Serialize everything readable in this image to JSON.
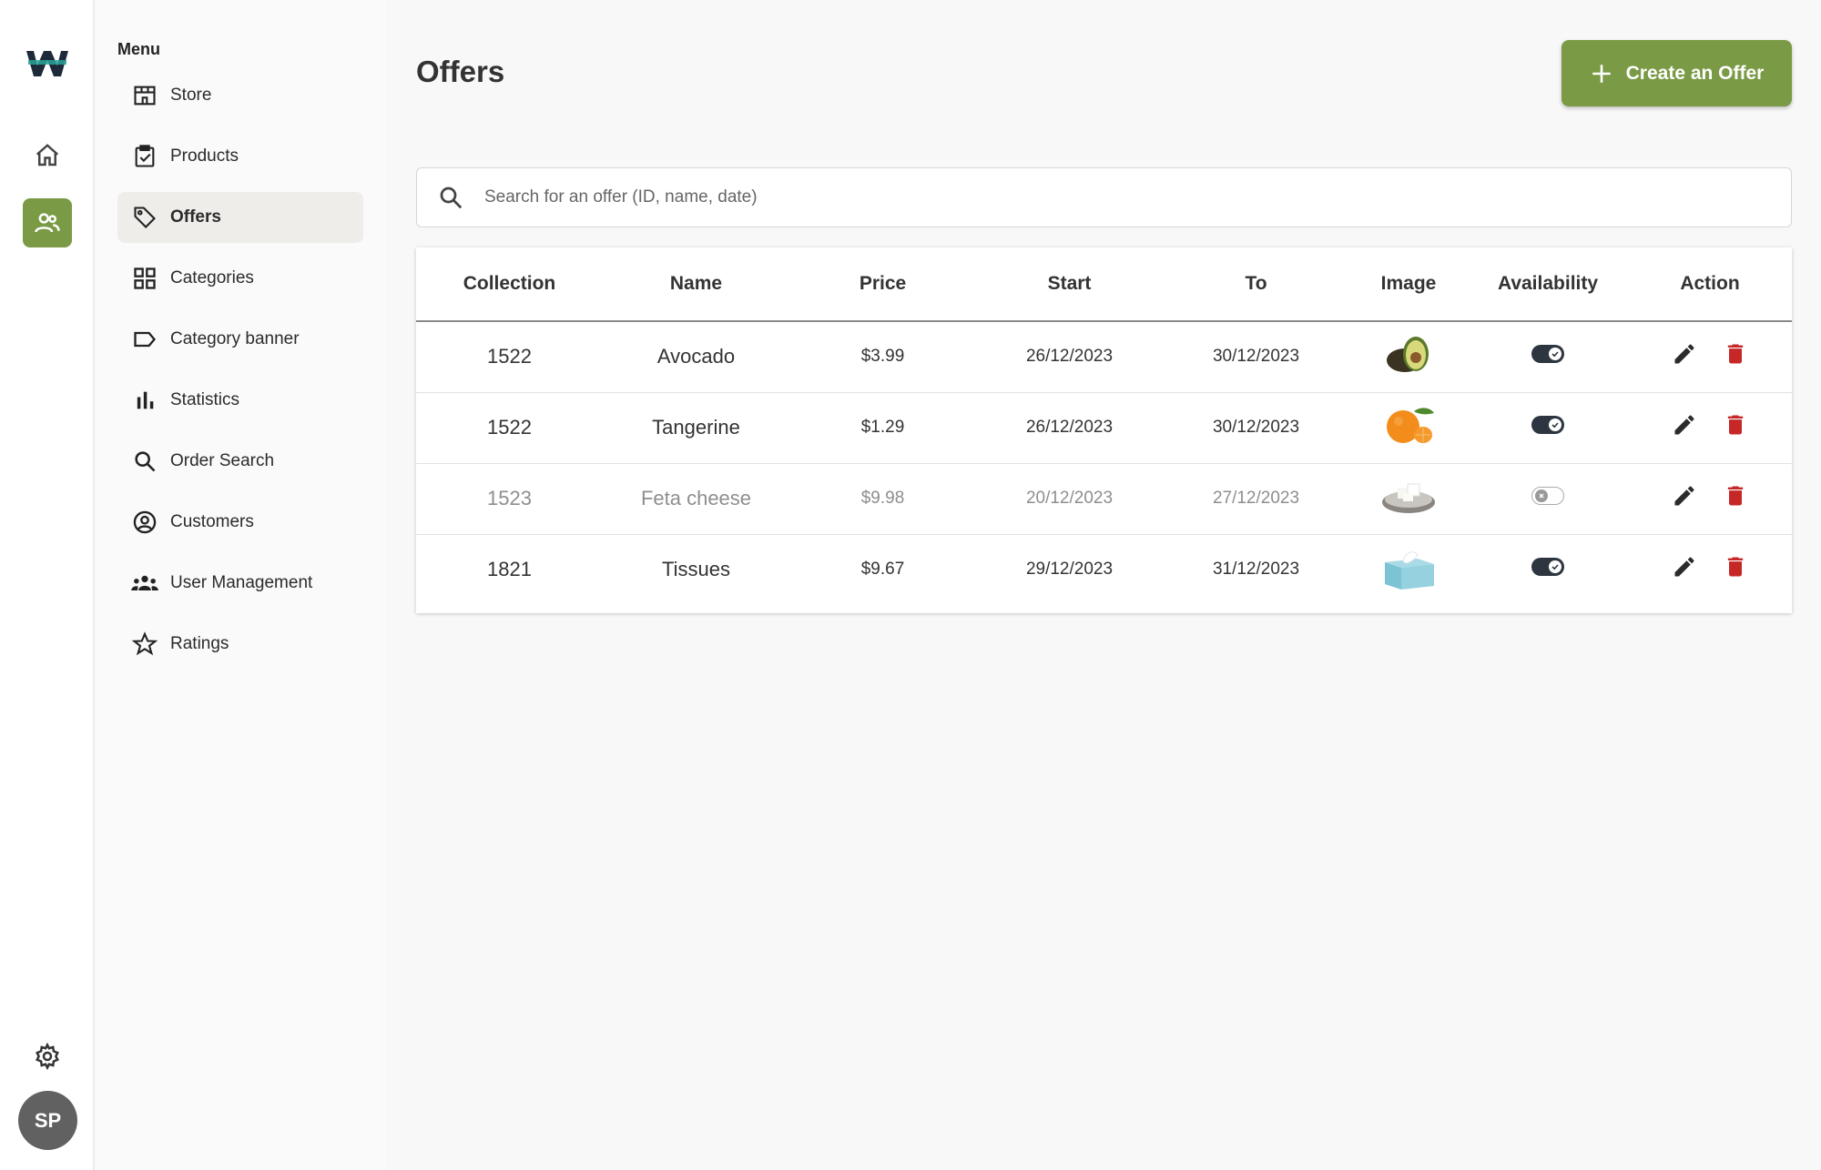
{
  "sidebar": {
    "menu_title": "Menu",
    "items": [
      {
        "label": "Store",
        "icon": "store-icon"
      },
      {
        "label": "Products",
        "icon": "clipboard-check-icon"
      },
      {
        "label": "Offers",
        "icon": "tag-icon",
        "active": true
      },
      {
        "label": "Categories",
        "icon": "grid-icon"
      },
      {
        "label": "Category banner",
        "icon": "label-icon"
      },
      {
        "label": "Statistics",
        "icon": "bar-chart-icon"
      },
      {
        "label": "Order Search",
        "icon": "search-icon"
      },
      {
        "label": "Customers",
        "icon": "account-circle-icon"
      },
      {
        "label": "User Management",
        "icon": "group-icon"
      },
      {
        "label": "Ratings",
        "icon": "star-icon"
      }
    ]
  },
  "rail": {
    "avatar_initials": "SP"
  },
  "header": {
    "title": "Offers",
    "create_label": "Create an Offer"
  },
  "search": {
    "placeholder": "Search for an offer (ID, name, date)"
  },
  "table": {
    "columns": [
      "Collection",
      "Name",
      "Price",
      "Start",
      "To",
      "Image",
      "Availability",
      "Action"
    ],
    "rows": [
      {
        "collection": "1522",
        "name": "Avocado",
        "price": "$3.99",
        "start": "26/12/2023",
        "to": "30/12/2023",
        "image": "avocado",
        "available": true
      },
      {
        "collection": "1522",
        "name": "Tangerine",
        "price": "$1.29",
        "start": "26/12/2023",
        "to": "30/12/2023",
        "image": "tangerine",
        "available": true
      },
      {
        "collection": "1523",
        "name": "Feta cheese",
        "price": "$9.98",
        "start": "20/12/2023",
        "to": "27/12/2023",
        "image": "feta-cheese",
        "available": false
      },
      {
        "collection": "1821",
        "name": "Tissues",
        "price": "$9.67",
        "start": "29/12/2023",
        "to": "31/12/2023",
        "image": "tissues",
        "available": true
      }
    ]
  },
  "colors": {
    "accent": "#7a9a45",
    "delete": "#c62828",
    "toggle_on": "#2d3640"
  }
}
